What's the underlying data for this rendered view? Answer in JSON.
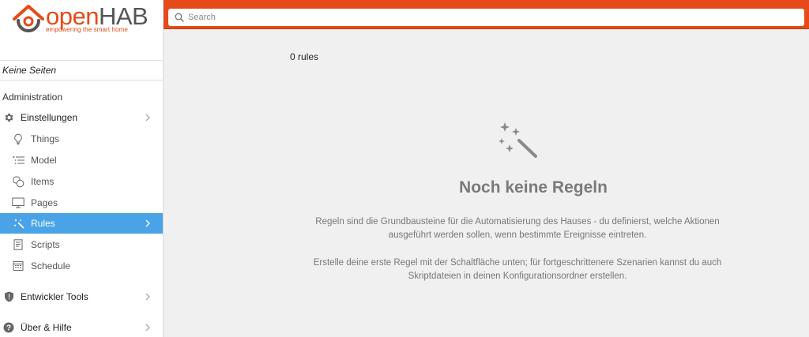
{
  "brand": {
    "logo_text_open": "open",
    "logo_text_hab": "HAB",
    "tagline": "empowering the smart home",
    "color": "#e64a19"
  },
  "sidebar": {
    "no_pages": "Keine Seiten",
    "admin_title": "Administration",
    "items": [
      {
        "label": "Einstellungen",
        "icon": "gear-icon"
      },
      {
        "label": "Things",
        "icon": "lightbulb-icon"
      },
      {
        "label": "Model",
        "icon": "list-tree-icon"
      },
      {
        "label": "Items",
        "icon": "items-icon"
      },
      {
        "label": "Pages",
        "icon": "monitor-icon"
      },
      {
        "label": "Rules",
        "icon": "magic-wand-icon",
        "active": true
      },
      {
        "label": "Scripts",
        "icon": "document-icon"
      },
      {
        "label": "Schedule",
        "icon": "calendar-icon"
      },
      {
        "label": "Entwickler Tools",
        "icon": "shield-icon"
      },
      {
        "label": "Über & Hilfe",
        "icon": "help-icon"
      }
    ],
    "active_color": "#4aa3e6"
  },
  "search": {
    "placeholder": "Search"
  },
  "main": {
    "rule_count": "0 rules",
    "empty_title": "Noch keine Regeln",
    "empty_text_1a": "Regeln sind die Grundbausteine für die Automatisierung des Hauses - du definierst, welche Aktionen",
    "empty_text_1b": "ausgeführt werden sollen, wenn bestimmte Ereignisse eintreten.",
    "empty_text_2a": "Erstelle deine erste Regel mit der Schaltfläche unten; für fortgeschrittenere Szenarien kannst du auch",
    "empty_text_2b": "Skriptdateien in deinen Konfigurationsordner erstellen."
  }
}
